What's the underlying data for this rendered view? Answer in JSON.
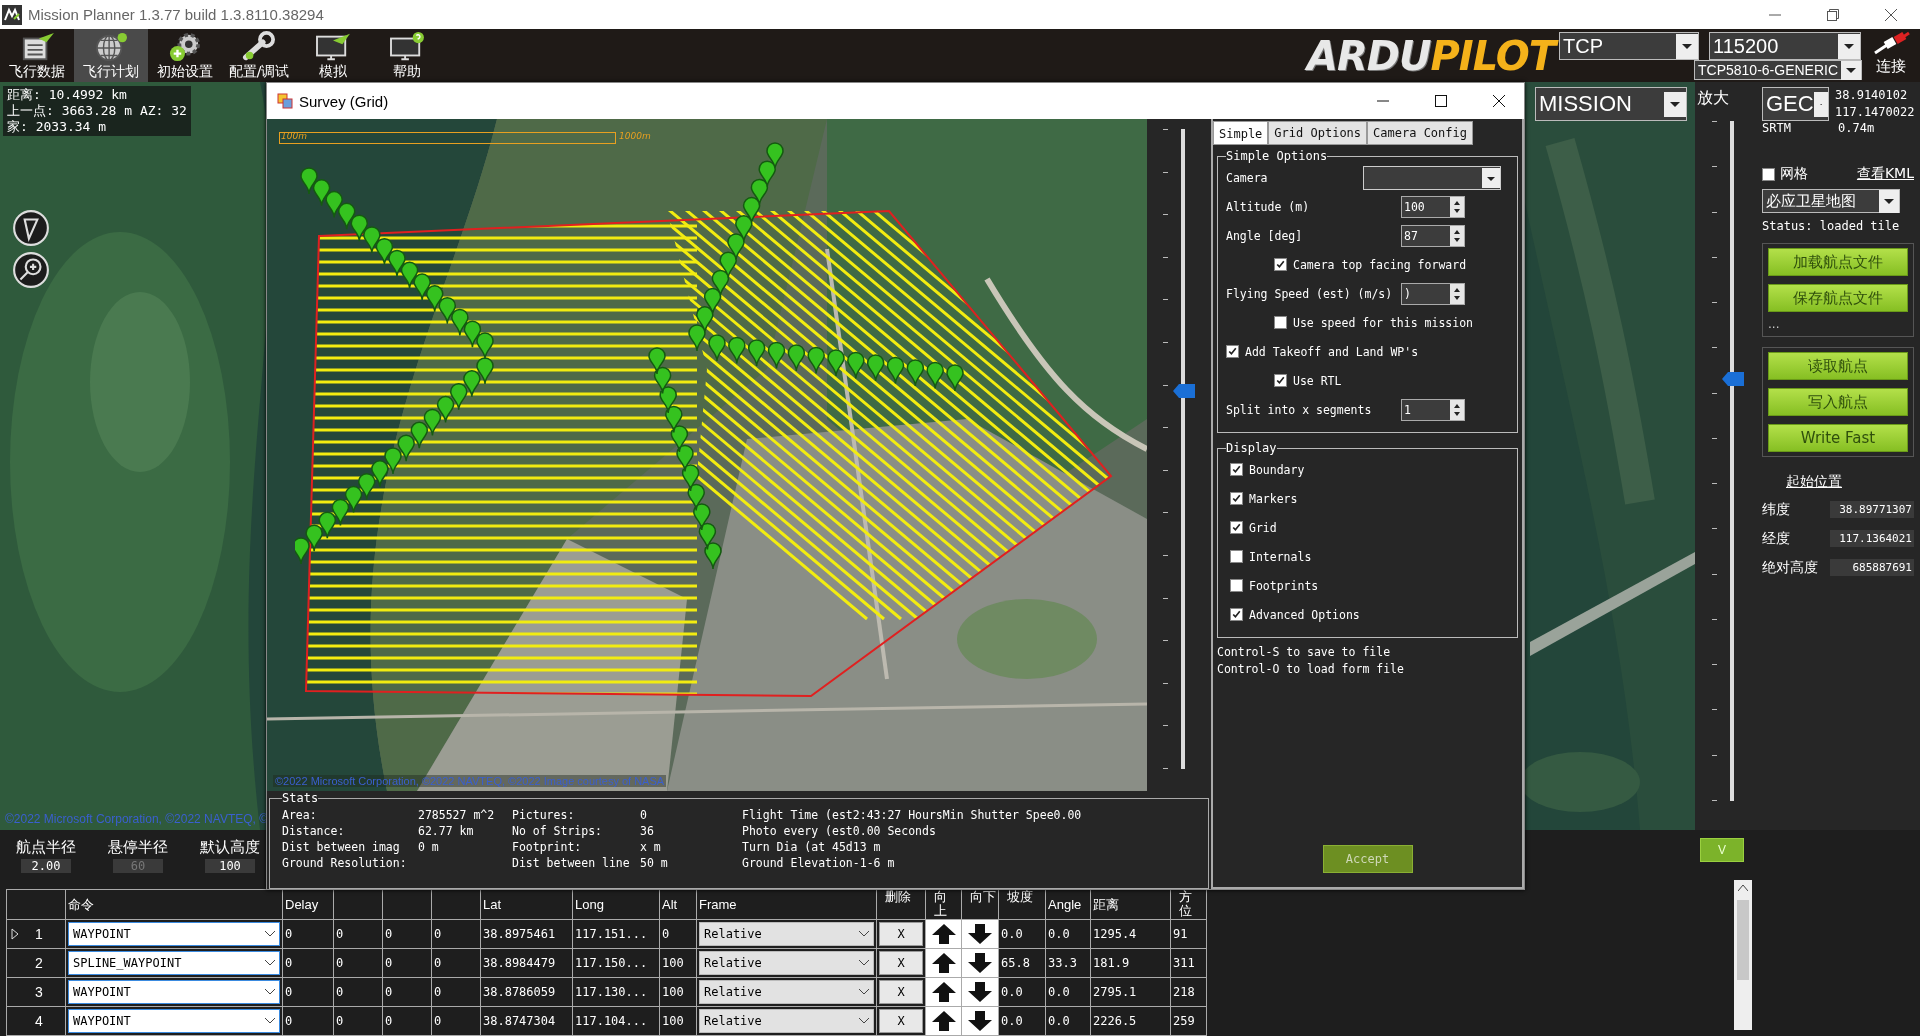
{
  "window": {
    "title": "Mission Planner 1.3.77 build 1.3.8110.38294"
  },
  "toolbar": {
    "buttons": [
      {
        "label": "飞行数据",
        "selected": false
      },
      {
        "label": "飞行计划",
        "selected": true
      },
      {
        "label": "初始设置",
        "selected": false
      },
      {
        "label": "配置/调试",
        "selected": false
      },
      {
        "label": "模拟",
        "selected": false
      },
      {
        "label": "帮助",
        "selected": false
      }
    ],
    "logo": {
      "text": "ARDU",
      "accent": "PILOT"
    },
    "connection": {
      "type": "TCP",
      "baud": "115200",
      "port": "TCP5810-6-GENERIC",
      "connect_label": "连接"
    }
  },
  "map": {
    "info_lines": [
      "距离: 10.4992 km",
      "上一点: 3663.28 m AZ: 32",
      "家: 2033.34 m"
    ],
    "attribution": "©2022 Microsoft Corporation, ©2022 NAVTEQ, ©",
    "mode": "MISSION",
    "zoom_label": "放大",
    "zoom": {
      "level": 0.62
    }
  },
  "sidebar": {
    "coord_system": "GEC",
    "lat": "38.9140102",
    "lng": "117.1470022",
    "alt_source": "SRTM",
    "alt": "0.74m",
    "grid": {
      "label": "网格",
      "checked": false
    },
    "kml_link": "查看KML",
    "map_type": "必应卫星地图",
    "status": "Status: loaded tile",
    "file_buttons": [
      "加载航点文件",
      "保存航点文件"
    ],
    "more": "...",
    "mission_buttons": [
      "读取航点",
      "写入航点",
      "Write Fast"
    ],
    "home": {
      "title": "起始位置",
      "fields": [
        {
          "label": "纬度",
          "value": "38.89771307"
        },
        {
          "label": "经度",
          "value": "117.1364021"
        },
        {
          "label": "绝对高度",
          "value": "685887691"
        }
      ]
    }
  },
  "survey": {
    "title": "Survey (Grid)",
    "map": {
      "scale_labels": [
        "100m",
        "1000m"
      ],
      "attribution": "©2022 Microsoft Corporation, ©2022 NAVTEQ, ©2022 Image courtesy of NASA",
      "zoom": {
        "level": 0.59
      }
    },
    "stats": {
      "title": "Stats",
      "columns": [
        [
          {
            "label": "Area:",
            "value": "2785527 m^2"
          },
          {
            "label": "Distance:",
            "value": "62.77 km"
          },
          {
            "label": "Dist between imag",
            "value": "0 m"
          },
          {
            "label": "Ground Resolution:"
          }
        ],
        [
          {
            "label": "Pictures:",
            "value": "0"
          },
          {
            "label": "No of Strips:",
            "value": "36"
          },
          {
            "label": "Footprint:",
            "value": "x m"
          },
          {
            "label": "Dist between line",
            "value": "50 m"
          }
        ],
        [
          {
            "label": "Flight Time (est",
            "value": "2:43:27 HoursMin Shutter Spee0.00"
          },
          {
            "label": "Photo every (est",
            "value": "0.00 Seconds"
          },
          {
            "label": "Turn Dia (at 45d",
            "value": "13 m"
          },
          {
            "label": "Ground Elevation",
            "value": "-1-6 m"
          }
        ]
      ]
    },
    "tabs": [
      {
        "label": "Simple",
        "selected": true
      },
      {
        "label": "Grid Options",
        "selected": false
      },
      {
        "label": "Camera Config",
        "selected": false
      }
    ],
    "simple_options": {
      "title": "Simple Options",
      "items": [
        {
          "kind": "combo",
          "label": "Camera"
        },
        {
          "kind": "spinner",
          "label": "Altitude (m)",
          "value": "100"
        },
        {
          "kind": "spinner",
          "label": "Angle [deg]",
          "value": "87",
          "children": [
            {
              "kind": "checkbox",
              "label": "Camera top facing forward",
              "checked": true
            }
          ]
        },
        {
          "kind": "spinner",
          "label": "Flying Speed (est) (m/s)",
          "value": ")",
          "children": [
            {
              "kind": "checkbox",
              "label": "Use speed for this mission",
              "checked": false
            }
          ]
        },
        {
          "kind": "checkbox",
          "label": "Add Takeoff and Land WP's",
          "checked": true,
          "children": [
            {
              "kind": "checkbox",
              "label": "Use RTL",
              "checked": true
            }
          ]
        },
        {
          "kind": "spinner",
          "label": "Split into x segments",
          "value": "1"
        }
      ]
    },
    "display": {
      "title": "Display",
      "items": [
        {
          "label": "Boundary",
          "checked": true
        },
        {
          "label": "Markers",
          "checked": true
        },
        {
          "label": "Grid",
          "checked": true
        },
        {
          "label": "Internals",
          "checked": false
        },
        {
          "label": "Footprints",
          "checked": false
        },
        {
          "label": "Advanced Options",
          "checked": true
        }
      ]
    },
    "notes": [
      "Control-S to save to file",
      "Control-O to load form file"
    ],
    "accept": "Accept"
  },
  "waypoint_defaults": [
    {
      "label": "航点半径",
      "value": "2.00",
      "disabled": false
    },
    {
      "label": "悬停半径",
      "value": "60",
      "disabled": true
    },
    {
      "label": "默认高度",
      "value": "100",
      "disabled": false
    }
  ],
  "collapse_button": "V",
  "table": {
    "columns": [
      {
        "label": "命令",
        "kind": "combo"
      },
      {
        "label": "Delay",
        "kind": "text"
      },
      {
        "kind": "text"
      },
      {
        "kind": "text"
      },
      {
        "kind": "text"
      },
      {
        "label": "Lat",
        "kind": "text"
      },
      {
        "label": "Long",
        "kind": "text"
      },
      {
        "label": "Alt",
        "kind": "text"
      },
      {
        "label": "Frame",
        "kind": "combo"
      },
      {
        "label": "删除",
        "kind": "button"
      },
      {
        "label": "向上",
        "kind": "up"
      },
      {
        "label": "向下",
        "kind": "down"
      },
      {
        "label": "坡度",
        "kind": "text"
      },
      {
        "label": "Angle",
        "kind": "text"
      },
      {
        "label": "距离",
        "kind": "text"
      },
      {
        "label": "方位",
        "kind": "text"
      }
    ],
    "rows": [
      {
        "number": "1",
        "current": true,
        "cells": [
          "WAYPOINT",
          "0",
          "0",
          "0",
          "0",
          "38.8975461",
          "117.151...",
          "0",
          "Relative",
          "X",
          {
            "kind": "up"
          },
          {
            "kind": "down"
          },
          "0.0",
          "0.0",
          "1295.4",
          "91"
        ]
      },
      {
        "number": "2",
        "current": false,
        "cells": [
          "SPLINE_WAYPOINT",
          "0",
          "0",
          "0",
          "0",
          "38.8984479",
          "117.150...",
          "100",
          "Relative",
          "X",
          {
            "kind": "up"
          },
          {
            "kind": "down"
          },
          "65.8",
          "33.3",
          "181.9",
          "311"
        ]
      },
      {
        "number": "3",
        "current": false,
        "cells": [
          "WAYPOINT",
          "0",
          "0",
          "0",
          "0",
          "38.8786059",
          "117.130...",
          "100",
          "Relative",
          "X",
          {
            "kind": "up"
          },
          {
            "kind": "down"
          },
          "0.0",
          "0.0",
          "2795.1",
          "218"
        ]
      },
      {
        "number": "4",
        "current": false,
        "cells": [
          "WAYPOINT",
          "0",
          "0",
          "0",
          "0",
          "38.8747304",
          "117.104...",
          "100",
          "Relative",
          "X",
          {
            "kind": "up"
          },
          {
            "kind": "down"
          },
          "0.0",
          "0.0",
          "2226.5",
          "259"
        ]
      }
    ]
  }
}
